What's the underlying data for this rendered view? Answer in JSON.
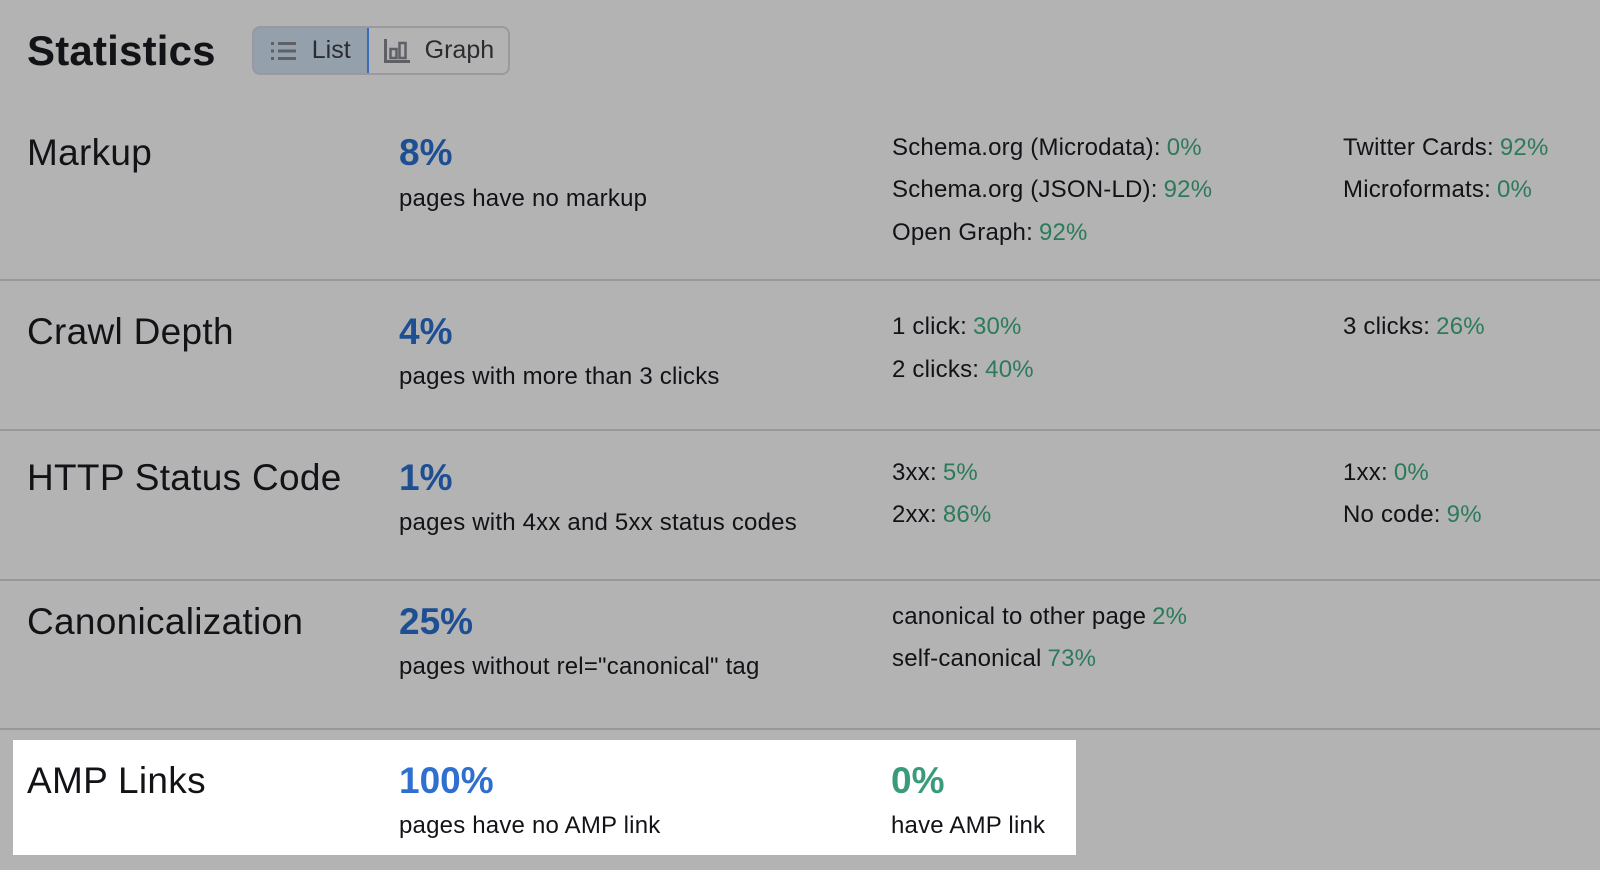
{
  "header": {
    "title": "Statistics",
    "view_toggle": {
      "list_label": "List",
      "list_icon": "list-icon",
      "graph_label": "Graph",
      "graph_icon": "bar-chart-icon",
      "selected": "List"
    }
  },
  "colors": {
    "primary_value": "#1e4f93",
    "sub_value": "#2d7a5b",
    "highlight_primary": "#2f6fd0",
    "highlight_secondary": "#3a9b7a",
    "active_toggle_border": "#3b6cb5"
  },
  "rows": [
    {
      "name": "Markup",
      "value": "8%",
      "description": "pages have no markup",
      "metrics": [
        {
          "label": "Schema.org (Microdata):",
          "value": "0%"
        },
        {
          "label": "Schema.org (JSON-LD):",
          "value": "92%"
        },
        {
          "label": "Open Graph:",
          "value": "92%"
        },
        {
          "label": "Twitter Cards:",
          "value": "92%"
        },
        {
          "label": "Microformats:",
          "value": "0%"
        }
      ]
    },
    {
      "name": "Crawl Depth",
      "value": "4%",
      "description": "pages with more than 3 clicks",
      "metrics": [
        {
          "label": "1 click:",
          "value": "30%"
        },
        {
          "label": "2 clicks:",
          "value": "40%"
        },
        {
          "label": "3 clicks:",
          "value": "26%"
        }
      ]
    },
    {
      "name": "HTTP Status Code",
      "value": "1%",
      "description": "pages with 4xx and 5xx status codes",
      "metrics": [
        {
          "label": "3xx:",
          "value": "5%"
        },
        {
          "label": "2xx:",
          "value": "86%"
        },
        {
          "label": "1xx:",
          "value": "0%"
        },
        {
          "label": "No code:",
          "value": "9%"
        }
      ]
    },
    {
      "name": "Canonicalization",
      "value": "25%",
      "description": "pages without rel=\"canonical\" tag",
      "metrics": [
        {
          "label": "canonical to other page",
          "value": "2%"
        },
        {
          "label": "self-canonical",
          "value": "73%"
        }
      ]
    },
    {
      "name": "AMP Links",
      "value": "100%",
      "description": "pages have no AMP link",
      "secondary_value": "0%",
      "secondary_description": "have AMP link",
      "highlighted": true
    }
  ]
}
